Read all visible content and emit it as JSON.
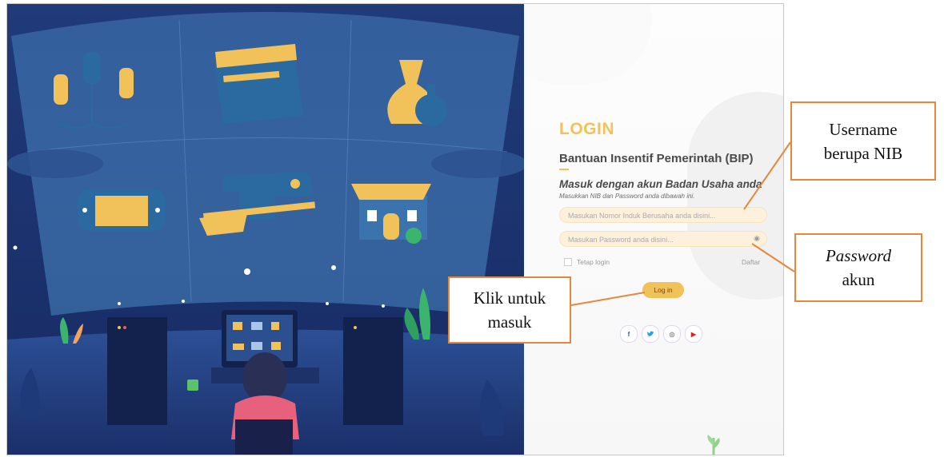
{
  "login": {
    "title": "LOGIN",
    "app_name": "Bantuan Insentif Pemerintah (BIP)",
    "subtitle": "Masuk dengan akun Badan Usaha anda",
    "hint": "Masukkan NIB dan Password anda dibawah ini.",
    "username_placeholder": "Masukan Nomor Induk Berusaha anda disini...",
    "password_placeholder": "Masukan Password anda disini...",
    "remember_label": "Tetap login",
    "register_link": "Daftar",
    "login_button": "Log in",
    "accent_color": "#f2c25a"
  },
  "socials": [
    {
      "icon": "facebook-icon",
      "glyph": "f",
      "color": "#3b5998"
    },
    {
      "icon": "twitter-icon",
      "glyph": "🐦",
      "color": "#1da1f2"
    },
    {
      "icon": "instagram-icon",
      "glyph": "◎",
      "color": "#888888"
    },
    {
      "icon": "youtube-icon",
      "glyph": "▶",
      "color": "#e02020"
    }
  ],
  "annotations": {
    "username_line1": "Username",
    "username_line2": "berupa NIB",
    "password_line1": "Password",
    "password_line2": "akun",
    "click_line1": "Klik untuk",
    "click_line2": "masuk",
    "color": "#e8873a"
  }
}
